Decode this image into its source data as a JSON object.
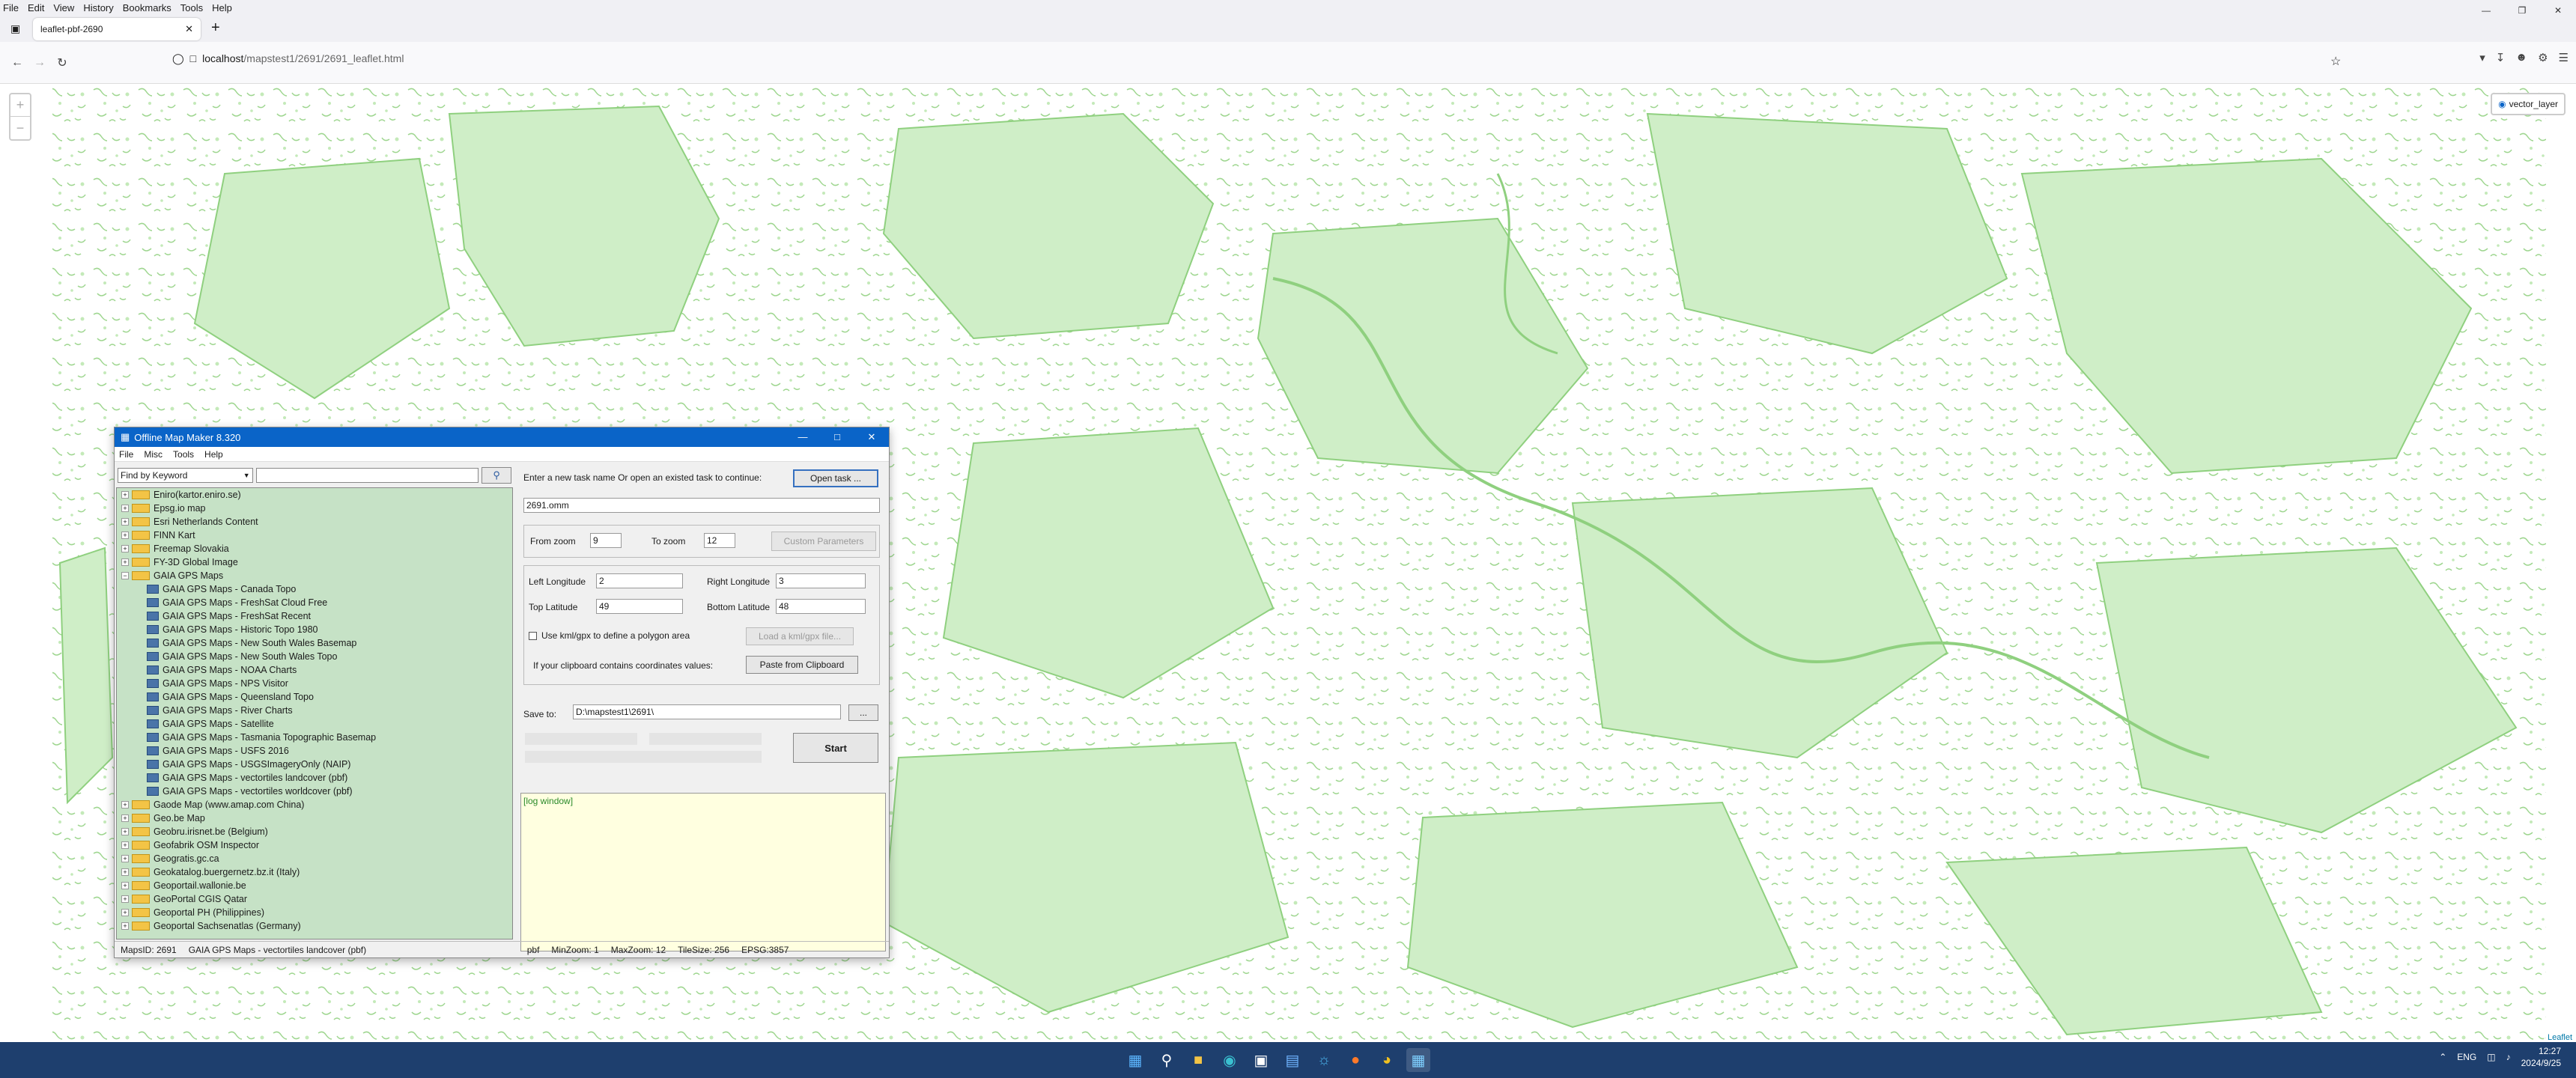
{
  "browser": {
    "menu": [
      "File",
      "Edit",
      "View",
      "History",
      "Bookmarks",
      "Tools",
      "Help"
    ],
    "tab_title": "leaflet-pbf-2690",
    "url_host": "localhost",
    "url_path": "/mapstest1/2691/2691_leaflet.html"
  },
  "map": {
    "zoom_in": "+",
    "zoom_out": "−",
    "layer_label": "vector_layer",
    "attribution": "Leaflet",
    "fill_color": "#cfeec7",
    "stroke_color": "#8fd07f"
  },
  "app": {
    "title": "Offline Map Maker 8.320",
    "menu": [
      "File",
      "Misc",
      "Tools",
      "Help"
    ],
    "find_mode": "Find by Keyword",
    "tree": [
      {
        "label": "Eniro(kartor.eniro.se)",
        "type": "folder",
        "expanded": false
      },
      {
        "label": "Epsg.io map",
        "type": "folder",
        "expanded": false
      },
      {
        "label": "Esri Netherlands Content",
        "type": "folder",
        "expanded": false
      },
      {
        "label": "FINN Kart",
        "type": "folder",
        "expanded": false
      },
      {
        "label": "Freemap Slovakia",
        "type": "folder",
        "expanded": false
      },
      {
        "label": "FY-3D Global Image",
        "type": "folder",
        "expanded": false
      },
      {
        "label": "GAIA GPS Maps",
        "type": "folder",
        "expanded": true
      },
      {
        "label": "GAIA GPS Maps - Canada Topo",
        "type": "leaf"
      },
      {
        "label": "GAIA GPS Maps - FreshSat Cloud Free",
        "type": "leaf"
      },
      {
        "label": "GAIA GPS Maps - FreshSat Recent",
        "type": "leaf"
      },
      {
        "label": "GAIA GPS Maps - Historic Topo 1980",
        "type": "leaf"
      },
      {
        "label": "GAIA GPS Maps - New South Wales Basemap",
        "type": "leaf"
      },
      {
        "label": "GAIA GPS Maps - New South Wales Topo",
        "type": "leaf"
      },
      {
        "label": "GAIA GPS Maps - NOAA Charts",
        "type": "leaf"
      },
      {
        "label": "GAIA GPS Maps - NPS Visitor",
        "type": "leaf"
      },
      {
        "label": "GAIA GPS Maps - Queensland Topo",
        "type": "leaf"
      },
      {
        "label": "GAIA GPS Maps - River Charts",
        "type": "leaf"
      },
      {
        "label": "GAIA GPS Maps - Satellite",
        "type": "leaf"
      },
      {
        "label": "GAIA GPS Maps - Tasmania Topographic Basemap",
        "type": "leaf"
      },
      {
        "label": "GAIA GPS Maps - USFS 2016",
        "type": "leaf"
      },
      {
        "label": "GAIA GPS Maps - USGSImageryOnly (NAIP)",
        "type": "leaf"
      },
      {
        "label": "GAIA GPS Maps - vectortiles landcover (pbf)",
        "type": "leaf"
      },
      {
        "label": "GAIA GPS Maps - vectortiles worldcover (pbf)",
        "type": "leaf"
      },
      {
        "label": "Gaode Map (www.amap.com China)",
        "type": "folder",
        "expanded": false
      },
      {
        "label": "Geo.be Map",
        "type": "folder",
        "expanded": false
      },
      {
        "label": "Geobru.irisnet.be (Belgium)",
        "type": "folder",
        "expanded": false
      },
      {
        "label": "Geofabrik OSM Inspector",
        "type": "folder",
        "expanded": false
      },
      {
        "label": "Geogratis.gc.ca",
        "type": "folder",
        "expanded": false
      },
      {
        "label": "Geokatalog.buergernetz.bz.it (Italy)",
        "type": "folder",
        "expanded": false
      },
      {
        "label": "Geoportail.wallonie.be",
        "type": "folder",
        "expanded": false
      },
      {
        "label": "GeoPortal CGIS Qatar",
        "type": "folder",
        "expanded": false
      },
      {
        "label": "Geoportal PH (Philippines)",
        "type": "folder",
        "expanded": false
      },
      {
        "label": "Geoportal Sachsenatlas (Germany)",
        "type": "folder",
        "expanded": false
      }
    ],
    "task_prompt": "Enter a new task name Or open an existed task to continue:",
    "open_task": "Open task ...",
    "task_name": "2691.omm",
    "from_zoom_label": "From zoom",
    "from_zoom": "9",
    "to_zoom_label": "To zoom",
    "to_zoom": "12",
    "custom_params": "Custom Parameters",
    "left_lon_label": "Left Longitude",
    "left_lon": "2",
    "right_lon_label": "Right Longitude",
    "right_lon": "3",
    "top_lat_label": "Top Latitude",
    "top_lat": "49",
    "bottom_lat_label": "Bottom Latitude",
    "bottom_lat": "48",
    "polygon_label": "Use kml/gpx to define a polygon area",
    "load_kml": "Load a kml/gpx file...",
    "clipboard_label": "If your clipboard contains coordinates values:",
    "paste_btn": "Paste from Clipboard",
    "save_label": "Save to:",
    "save_path": "D:\\mapstest1\\2691\\",
    "browse": "...",
    "start": "Start",
    "log": "[log window]",
    "status": [
      "MapsID: 2691",
      "GAIA GPS Maps - vectortiles landcover (pbf)",
      "pbf",
      "MinZoom: 1",
      "MaxZoom: 12",
      "TileSize: 256",
      "EPSG:3857"
    ]
  },
  "taskbar": {
    "lang": "ENG",
    "time": "12:27",
    "date": "2024/9/25"
  }
}
